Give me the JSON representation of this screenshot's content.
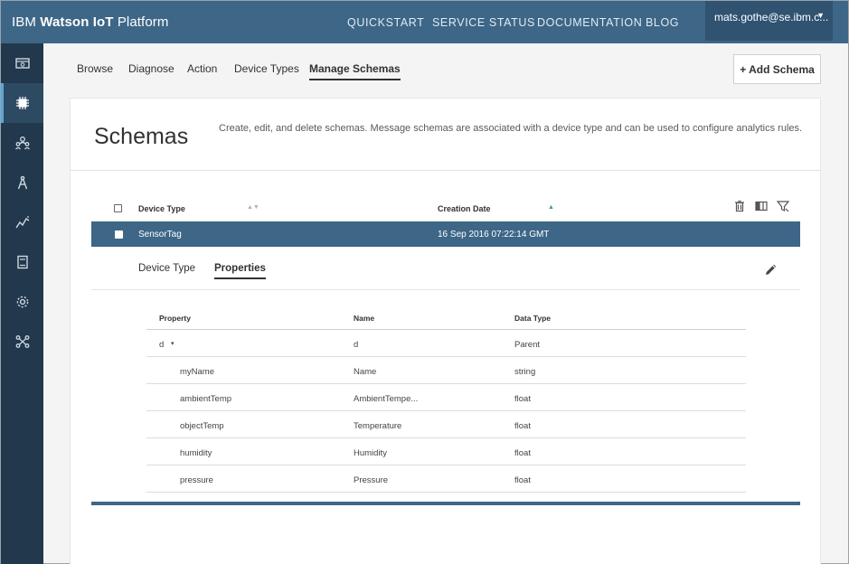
{
  "header": {
    "brand_ibm": "IBM",
    "brand_strong": "Watson IoT",
    "brand_rest": "Platform",
    "nav": [
      "QUICKSTART",
      "SERVICE STATUS",
      "DOCUMENTATION",
      "BLOG"
    ],
    "user": "mats.gothe@se.ibm.c...",
    "user_caret": "▼"
  },
  "sidebar": {
    "items": [
      "boards-icon",
      "devices-icon",
      "members-icon",
      "rules-icon",
      "analytics-icon",
      "apps-icon",
      "settings-icon",
      "extensions-icon"
    ],
    "active_index": 1
  },
  "subnav": {
    "tabs": [
      "Browse",
      "Diagnose",
      "Action",
      "Device Types",
      "Manage Schemas"
    ],
    "active": "Manage Schemas",
    "add_label": "+ Add Schema"
  },
  "schemas": {
    "title": "Schemas",
    "description": "Create, edit, and delete schemas. Message schemas are associated with a device type and can be used to configure analytics rules.",
    "columns": {
      "device_type": "Device Type",
      "creation_date": "Creation Date"
    },
    "selected_row": {
      "device_type": "SensorTag",
      "creation_date": "16 Sep 2016 07:22:14 GMT"
    },
    "tabs": [
      "Device Type",
      "Properties"
    ],
    "active_tab": "Properties",
    "properties": {
      "columns": [
        "Property",
        "Name",
        "Data Type"
      ],
      "rows": [
        {
          "property": "d",
          "name": "d",
          "type": "Parent",
          "parent": true
        },
        {
          "property": "myName",
          "name": "Name",
          "type": "string"
        },
        {
          "property": "ambientTemp",
          "name": "AmbientTempe...",
          "type": "float"
        },
        {
          "property": "objectTemp",
          "name": "Temperature",
          "type": "float"
        },
        {
          "property": "humidity",
          "name": "Humidity",
          "type": "float"
        },
        {
          "property": "pressure",
          "name": "Pressure",
          "type": "float"
        }
      ]
    }
  },
  "colors": {
    "header": "#3d6687",
    "sidebar": "#21384d",
    "accent": "#5aa8d8"
  }
}
